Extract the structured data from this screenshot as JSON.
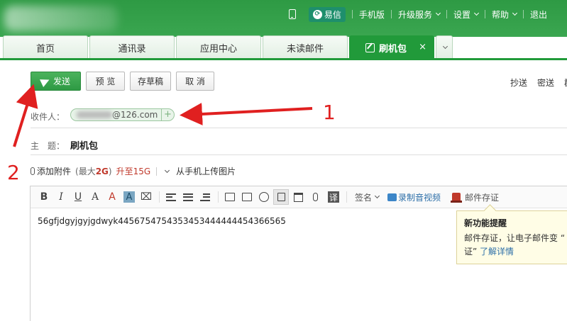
{
  "header": {
    "nav": [
      {
        "label": "易信",
        "icon": "yixin-icon"
      },
      {
        "label": "手机版"
      },
      {
        "label": "升级服务",
        "dropdown": true
      },
      {
        "label": "设置",
        "dropdown": true
      },
      {
        "label": "帮助",
        "dropdown": true
      },
      {
        "label": "退出"
      }
    ]
  },
  "tabs": [
    {
      "label": "首页"
    },
    {
      "label": "通讯录"
    },
    {
      "label": "应用中心"
    },
    {
      "label": "未读邮件"
    },
    {
      "label": "刷机包",
      "active": true,
      "close": "×"
    }
  ],
  "toolbar": {
    "send_label": "发送",
    "preview_label": "预 览",
    "draft_label": "存草稿",
    "cancel_label": "取 消",
    "cc_label": "抄送",
    "bcc_label": "密送",
    "group_label": "群"
  },
  "recipient": {
    "label": "收件人：",
    "address_domain": "@126.com",
    "add_symbol": "+"
  },
  "subject": {
    "label": "主　题：",
    "value": "刷机包"
  },
  "attachments": {
    "add_label": "添加附件",
    "limit_prefix": "(最大",
    "limit_value": "2G",
    "limit_suffix": ")",
    "upgrade_label": "升至15G",
    "upload_label": "从手机上传图片"
  },
  "editor": {
    "toolbar": {
      "bold": "B",
      "italic": "I",
      "underline": "U",
      "font_size": "A",
      "font_color": "A",
      "highlight": "A",
      "translate": "译",
      "signature_label": "签名",
      "video_label": "录制音视频",
      "certify_label": "邮件存证"
    },
    "body": "56gfjdgyjgyjgdwyk4456754754353453444444454366565"
  },
  "tooltip": {
    "title": "新功能提醒",
    "line1": "邮件存证，让电子邮件变 “",
    "line2_quote": "证” ",
    "more_label": "了解详情"
  },
  "annotations": {
    "label_1": "1",
    "label_2": "2",
    "color": "#e02020"
  },
  "colors": {
    "brand_green": "#2e9a44",
    "active_tab": "#219a3a",
    "upgrade_red": "#c0392b"
  }
}
